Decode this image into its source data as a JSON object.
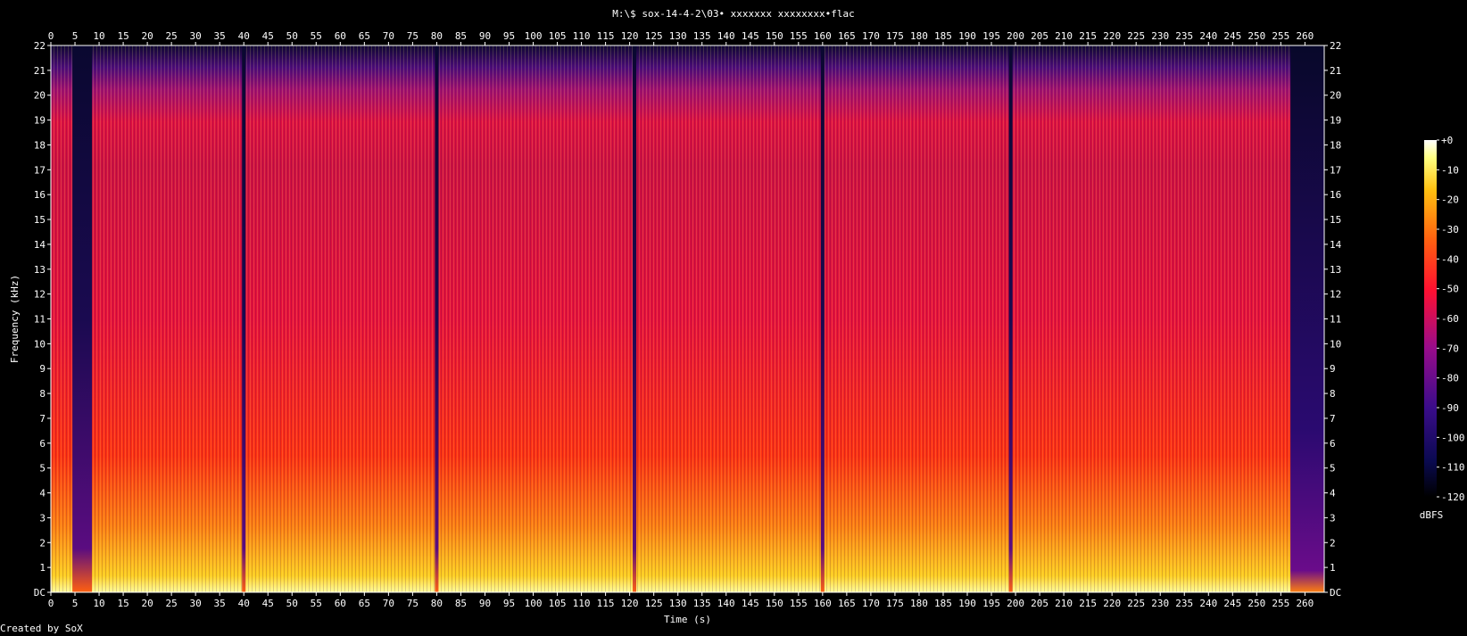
{
  "chart_data": {
    "type": "heatmap",
    "title": "M:\\$ sox-14-4-2\\03• xxxxxxx xxxxxxxx•flac",
    "xlabel": "Time (s)",
    "ylabel": "Frequency (kHz)",
    "xlim": [
      0,
      264
    ],
    "ylim": [
      0,
      22
    ],
    "x_ticks": [
      "0",
      "5",
      "10",
      "15",
      "20",
      "25",
      "30",
      "35",
      "40",
      "45",
      "50",
      "55",
      "60",
      "65",
      "70",
      "75",
      "80",
      "85",
      "90",
      "95",
      "100",
      "105",
      "110",
      "115",
      "120",
      "125",
      "130",
      "135",
      "140",
      "145",
      "150",
      "155",
      "160",
      "165",
      "170",
      "175",
      "180",
      "185",
      "190",
      "195",
      "200",
      "205",
      "210",
      "215",
      "220",
      "225",
      "230",
      "235",
      "240",
      "245",
      "250",
      "255",
      "260"
    ],
    "y_ticks": [
      "DC",
      "1",
      "2",
      "3",
      "4",
      "5",
      "6",
      "7",
      "8",
      "9",
      "10",
      "11",
      "12",
      "13",
      "14",
      "15",
      "16",
      "17",
      "18",
      "19",
      "20",
      "21",
      "22"
    ],
    "colorbar": {
      "label": "dBFS",
      "range": [
        -120,
        0
      ],
      "ticks": [
        "+0",
        "-10",
        "-20",
        "-30",
        "-40",
        "-50",
        "-60",
        "-70",
        "-80",
        "-90",
        "-100",
        "-110",
        "-120"
      ]
    },
    "quiet_gaps_s": [
      6.5,
      40,
      80,
      121,
      160,
      199,
      257
    ],
    "footer": "Created by SoX",
    "colors": {
      "hot": "#ffff66",
      "mid": "#ff2010",
      "cool": "#7a10a0",
      "cold": "#0a0a40"
    }
  }
}
